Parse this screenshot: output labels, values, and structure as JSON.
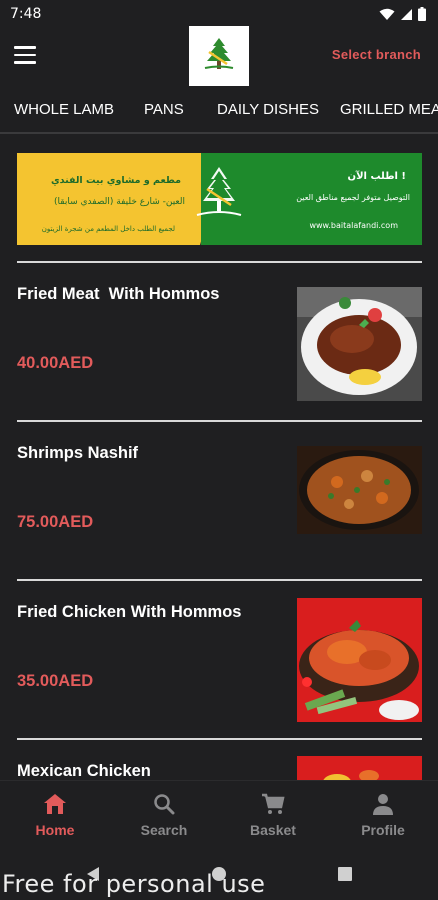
{
  "status_bar": {
    "time": "7:48"
  },
  "app_bar": {
    "select_branch": "Select branch"
  },
  "tabs": [
    {
      "label": "WHOLE LAMB"
    },
    {
      "label": "PANS",
      "active": true
    },
    {
      "label": "DAILY DISHES"
    },
    {
      "label": "GRILLED MEAT"
    }
  ],
  "banner": {
    "left_line1": "مطعم و مشاوي بيت الفندي",
    "left_line2": "العين- شارع خليفة (الصفدي سابقا)",
    "left_line3": "لجميع الطلب داخل المطعم من شجرة الزيتون",
    "right_line1": "اطلب الآن !",
    "right_line2": "التوصيل متوفر لجميع مناطق العين",
    "right_url": "www.baitalafandi.com"
  },
  "menu_items": [
    {
      "name": "Fried Meat  With Hommos",
      "price": "40.00AED",
      "image": "fried-meat-plate"
    },
    {
      "name": "Shrimps Nashif",
      "price": "75.00AED",
      "image": "shrimps-pan"
    },
    {
      "name": "Fried Chicken With Hommos",
      "price": "35.00AED",
      "image": "fried-chicken-plate"
    },
    {
      "name": "Mexican Chicken",
      "price": "",
      "image": "mexican-chicken"
    }
  ],
  "bottom_nav": [
    {
      "label": "Home",
      "icon": "home-icon",
      "active": true
    },
    {
      "label": "Search",
      "icon": "search-icon"
    },
    {
      "label": "Basket",
      "icon": "cart-icon"
    },
    {
      "label": "Profile",
      "icon": "person-icon"
    }
  ],
  "watermark": "Free for personal use",
  "colors": {
    "accent": "#e25b5b",
    "background": "#1f1f21",
    "banner_yellow": "#f4c430",
    "banner_green": "#1e8a2c"
  }
}
